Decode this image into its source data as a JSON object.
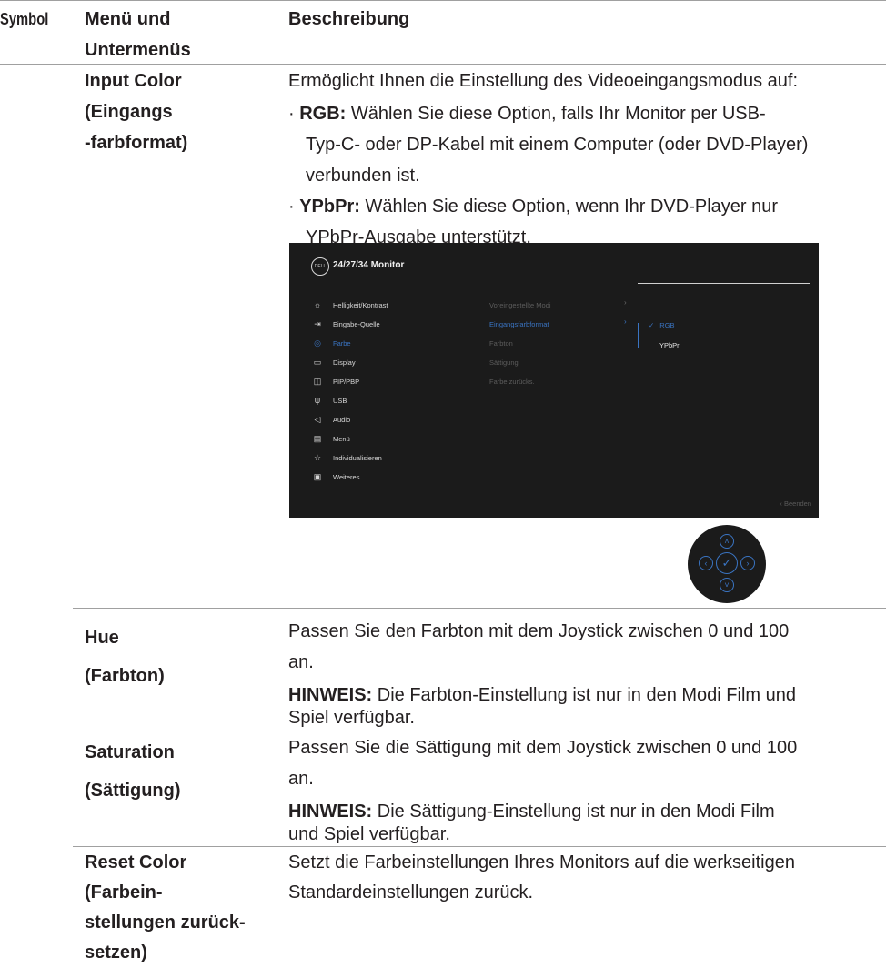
{
  "header": {
    "symbol": "Symbol",
    "menu_line1": "Menü und",
    "menu_line2": "Untermenüs",
    "description": "Beschreibung"
  },
  "rows": {
    "input_color": {
      "title_line1": "Input Color",
      "title_line2": "(Eingangs",
      "title_line3": "-farbformat)",
      "intro": "Ermöglicht Ihnen die Einstellung des Videoeingangsmodus auf:",
      "bullet1_label": "RGB:",
      "bullet1_line1": " Wählen Sie diese Option, falls Ihr Monitor per USB-",
      "bullet1_line2": "Typ-C- oder DP-Kabel mit einem Computer (oder DVD-Player)",
      "bullet1_line3": "verbunden ist.",
      "bullet2_label": "YPbPr:",
      "bullet2_line1": " Wählen Sie diese Option, wenn Ihr DVD-Player nur",
      "bullet2_line2": "YPbPr-Ausgabe unterstützt."
    },
    "hue": {
      "title_line1": "Hue",
      "title_line2": "(Farbton)",
      "desc_line1": "Passen Sie den Farbton mit dem Joystick zwischen 0 und 100",
      "desc_line2": "an.",
      "note_label": "HINWEIS:",
      "note_line1": " Die Farbton-Einstellung ist nur in den Modi Film und",
      "note_line2": "Spiel verfügbar."
    },
    "saturation": {
      "title_line1": "Saturation",
      "title_line2": "(Sättigung)",
      "desc_line1": "Passen Sie die Sättigung mit dem Joystick zwischen 0 und 100",
      "desc_line2": "an.",
      "note_label": "HINWEIS:",
      "note_line1": " Die Sättigung-Einstellung ist nur in den Modi Film",
      "note_line2": "und Spiel verfügbar."
    },
    "reset_color": {
      "title_line1": "Reset Color",
      "title_line2": "(Farbein-",
      "title_line3": "stellungen zurück-",
      "title_line4": "setzen)",
      "desc_line1": "Setzt die Farbeinstellungen Ihres Monitors auf die werkseitigen",
      "desc_line2": "Standardeinstellungen zurück."
    }
  },
  "osd": {
    "logo": "DELL",
    "title": "24/27/34 Monitor",
    "main_menu": [
      {
        "label": "Helligkeit/Kontrast",
        "icon": "sun-icon"
      },
      {
        "label": "Eingabe-Quelle",
        "icon": "input-source-icon"
      },
      {
        "label": "Farbe",
        "icon": "palette-icon"
      },
      {
        "label": "Display",
        "icon": "monitor-icon"
      },
      {
        "label": "PIP/PBP",
        "icon": "pip-icon"
      },
      {
        "label": "USB",
        "icon": "usb-icon"
      },
      {
        "label": "Audio",
        "icon": "speaker-icon"
      },
      {
        "label": "Menü",
        "icon": "menu-icon"
      },
      {
        "label": "Individualisieren",
        "icon": "star-icon"
      },
      {
        "label": "Weiteres",
        "icon": "info-icon"
      }
    ],
    "sub_menu": [
      "Voreingestellte Modi",
      "Eingangsfarbformat",
      "Farbton",
      "Sättigung",
      "Farbe zurücks."
    ],
    "options": [
      "RGB",
      "YPbPr"
    ],
    "exit": "Beenden",
    "accent_color": "#3a74c2"
  }
}
